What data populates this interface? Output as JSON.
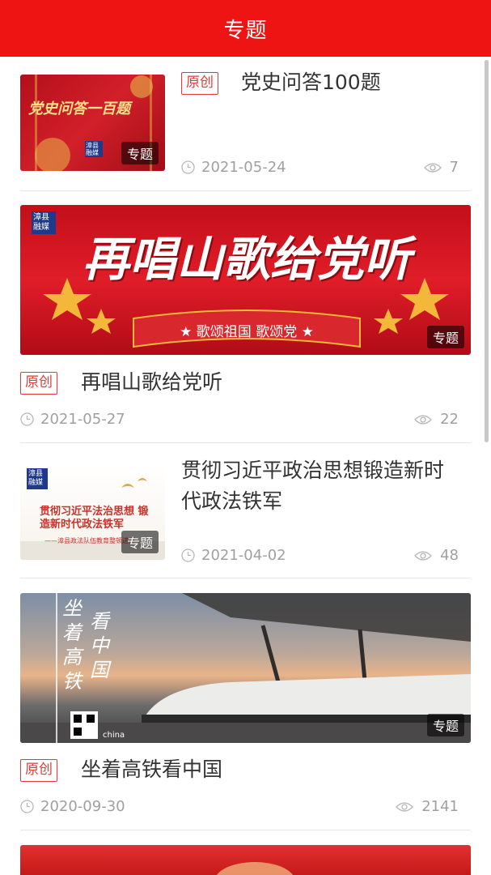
{
  "header": {
    "title": "专题"
  },
  "items": [
    {
      "badge": "原创",
      "title": "党史问答100题",
      "date": "2021-05-24",
      "views": "7",
      "tag": "专题",
      "thumb_text": "党史问答一百题",
      "logo": "漳县融媒"
    },
    {
      "badge": "原创",
      "title": "再唱山歌给党听",
      "date": "2021-05-27",
      "views": "22",
      "tag": "专题",
      "banner_text": "再唱山歌给党听",
      "banner_ribbon": "★ 歌颂祖国 歌颂党 ★",
      "logo": "漳县融媒"
    },
    {
      "title": "贯彻习近平政治思想锻造新时代政法铁军",
      "date": "2021-04-02",
      "views": "48",
      "tag": "专题",
      "thumb_text": "贯彻习近平法治思想 锻造新时代政法铁军",
      "thumb_subtext": "——漳县政法队伍教育整顿进行",
      "logo": "漳县融媒"
    },
    {
      "badge": "原创",
      "title": "坐着高铁看中国",
      "date": "2020-09-30",
      "views": "2141",
      "tag": "专题",
      "banner_text_left": "坐着高铁",
      "banner_text_right": "看中国",
      "banner_small": "china"
    }
  ],
  "colors": {
    "header": "#ef1414",
    "badge": "#e23a3a"
  }
}
